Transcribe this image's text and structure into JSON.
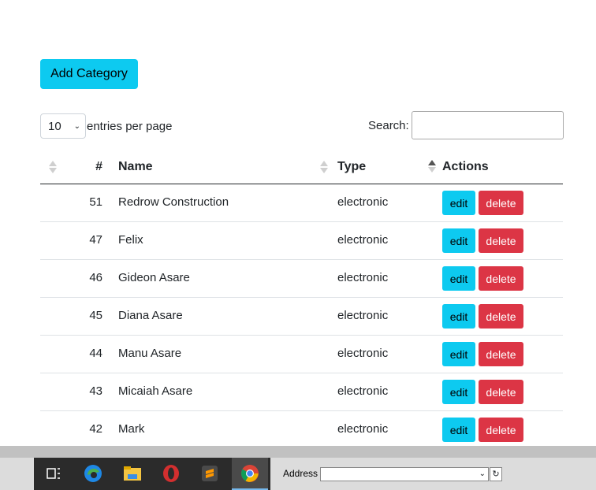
{
  "toolbar": {
    "add_label": "Add Category"
  },
  "entries": {
    "selected": "10",
    "label": "entries per page"
  },
  "search": {
    "label": "Search:",
    "value": ""
  },
  "table": {
    "headers": {
      "num": "#",
      "name": "Name",
      "type": "Type",
      "actions": "Actions"
    },
    "rows": [
      {
        "id": "51",
        "name": "Redrow Construction",
        "type": "electronic",
        "edit": "edit",
        "delete": "delete"
      },
      {
        "id": "47",
        "name": "Felix",
        "type": "electronic",
        "edit": "edit",
        "delete": "delete"
      },
      {
        "id": "46",
        "name": "Gideon Asare",
        "type": "electronic",
        "edit": "edit",
        "delete": "delete"
      },
      {
        "id": "45",
        "name": "Diana Asare",
        "type": "electronic",
        "edit": "edit",
        "delete": "delete"
      },
      {
        "id": "44",
        "name": "Manu Asare",
        "type": "electronic",
        "edit": "edit",
        "delete": "delete"
      },
      {
        "id": "43",
        "name": "Micaiah Asare",
        "type": "electronic",
        "edit": "edit",
        "delete": "delete"
      },
      {
        "id": "42",
        "name": "Mark",
        "type": "electronic",
        "edit": "edit",
        "delete": "delete"
      }
    ]
  },
  "taskbar": {
    "address_label": "Address",
    "icons": [
      "task-view-icon",
      "edge-icon",
      "file-explorer-icon",
      "opera-icon",
      "sublime-text-icon",
      "chrome-icon"
    ]
  },
  "colors": {
    "info": "#0dcaf0",
    "danger": "#dc3545"
  }
}
